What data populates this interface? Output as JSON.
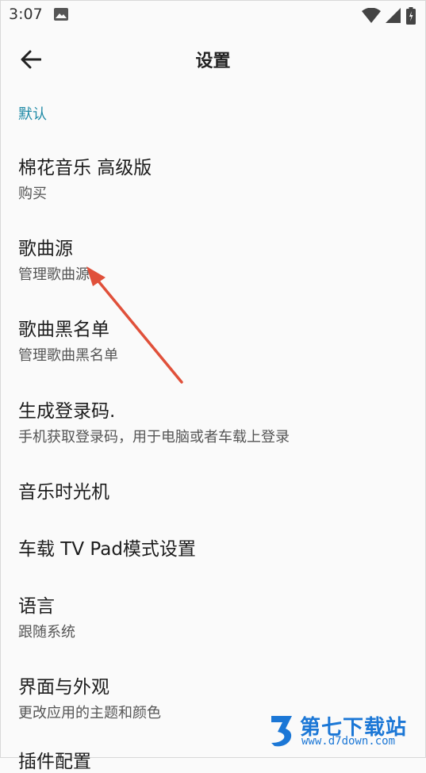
{
  "status_bar": {
    "time": "3:07",
    "icons": [
      "image-icon",
      "wifi-icon",
      "signal-icon",
      "battery-icon"
    ]
  },
  "app_bar": {
    "title": "设置",
    "back_icon": "arrow-left-icon"
  },
  "section": {
    "header": "默认"
  },
  "preferences": [
    {
      "title": "棉花音乐 高级版",
      "summary": "购买"
    },
    {
      "title": "歌曲源",
      "summary": "管理歌曲源"
    },
    {
      "title": "歌曲黑名单",
      "summary": "管理歌曲黑名单"
    },
    {
      "title": "生成登录码.",
      "summary": "手机获取登录码，用于电脑或者车载上登录"
    },
    {
      "title": "音乐时光机",
      "summary": ""
    },
    {
      "title": "车载 TV Pad模式设置",
      "summary": ""
    },
    {
      "title": "语言",
      "summary": "跟随系统"
    },
    {
      "title": "界面与外观",
      "summary": "更改应用的主题和颜色"
    },
    {
      "title": "插件配置",
      "summary": ""
    }
  ],
  "watermark": {
    "name": "第七下载站",
    "url": "www.d7down.com"
  },
  "colors": {
    "accent": "#1f8aa6",
    "annotation_arrow": "#e0503a",
    "watermark": "#1b77d6",
    "background": "#fafafa"
  }
}
